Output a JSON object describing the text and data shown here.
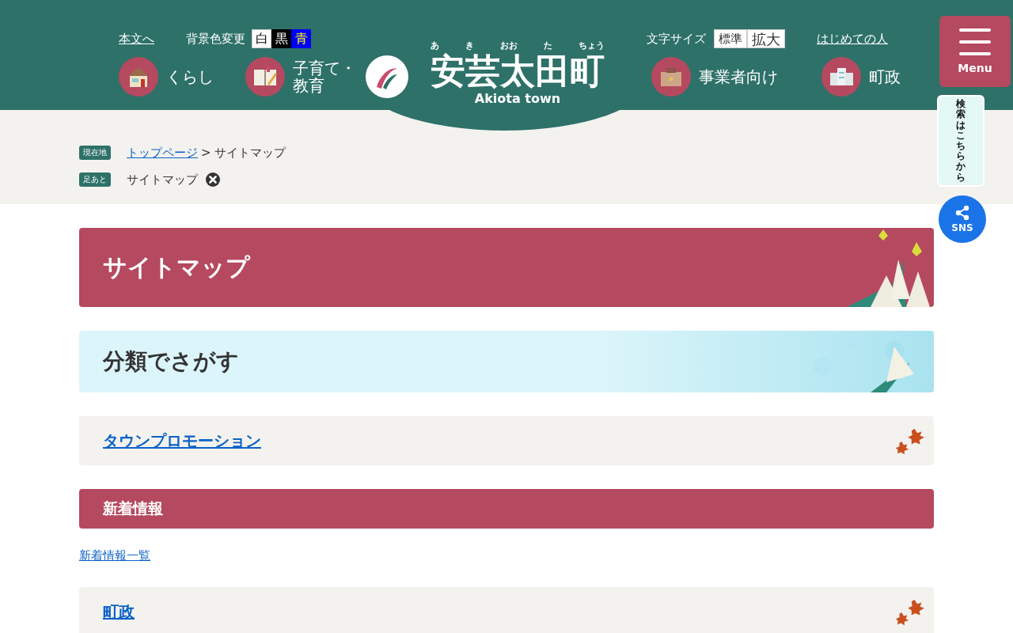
{
  "header": {
    "skip_link": "本文へ",
    "bg_color": {
      "label": "背景色変更",
      "options": [
        {
          "label": "白",
          "kind": "white"
        },
        {
          "label": "黒",
          "kind": "black"
        },
        {
          "label": "青",
          "kind": "blue"
        }
      ]
    },
    "font_size": {
      "label": "文字サイズ",
      "options": [
        "標準",
        "拡大"
      ]
    },
    "first_time_link": "はじめての人",
    "nav_left": [
      {
        "lines": [
          "くらし"
        ],
        "kind": "house"
      },
      {
        "lines": [
          "子育て・",
          "教育"
        ],
        "kind": "book"
      }
    ],
    "nav_right": [
      {
        "lines": [
          "事業者向け"
        ],
        "kind": "briefcase"
      },
      {
        "lines": [
          "町政"
        ],
        "kind": "building"
      }
    ],
    "logo": {
      "ruby": [
        "あ",
        "き",
        "おお",
        "た",
        "ちょう"
      ],
      "name": "安芸太田町",
      "name_en": "Akiota town"
    },
    "menu_button": "Menu"
  },
  "search_tab": "検索はこちらから",
  "sns_button": "SNS",
  "breadcrumb": {
    "label": "現在地",
    "links": [
      "トップページ"
    ],
    "separator": ">",
    "current": "サイトマップ"
  },
  "footprint": {
    "label": "足あと",
    "items": [
      "サイトマップ"
    ]
  },
  "page_title": "サイトマップ",
  "section_heading": "分類でさがす",
  "categories": [
    {
      "title": "タウンプロモーション",
      "kind": "plain"
    },
    {
      "title": "新着情報",
      "kind": "accent",
      "links": [
        "新着情報一覧"
      ]
    },
    {
      "title": "町政",
      "kind": "plain"
    }
  ]
}
